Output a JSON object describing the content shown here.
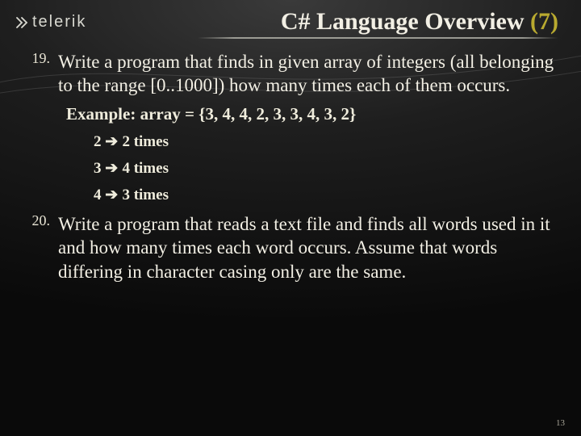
{
  "logo": {
    "text": "telerik"
  },
  "title": {
    "main": "C# Language Overview ",
    "accent": "(7)"
  },
  "items": [
    {
      "num": "19.",
      "text": "Write a program that finds in given array of integers (all belonging to the range [0..1000]) how many times each of them occurs."
    },
    {
      "num": "20.",
      "text": "Write a program that reads a text file and finds all words used in it and how many times each word occurs. Assume that words differing in character casing only are the same."
    }
  ],
  "example": {
    "label": "Example: array = {3, 4, 4, 2, 3, 3, 4, 3, 2}",
    "lines": [
      {
        "left": "2",
        "right": "2 times"
      },
      {
        "left": "3",
        "right": "4 times"
      },
      {
        "left": "4",
        "right": "3 times"
      }
    ]
  },
  "pageNumber": "13"
}
